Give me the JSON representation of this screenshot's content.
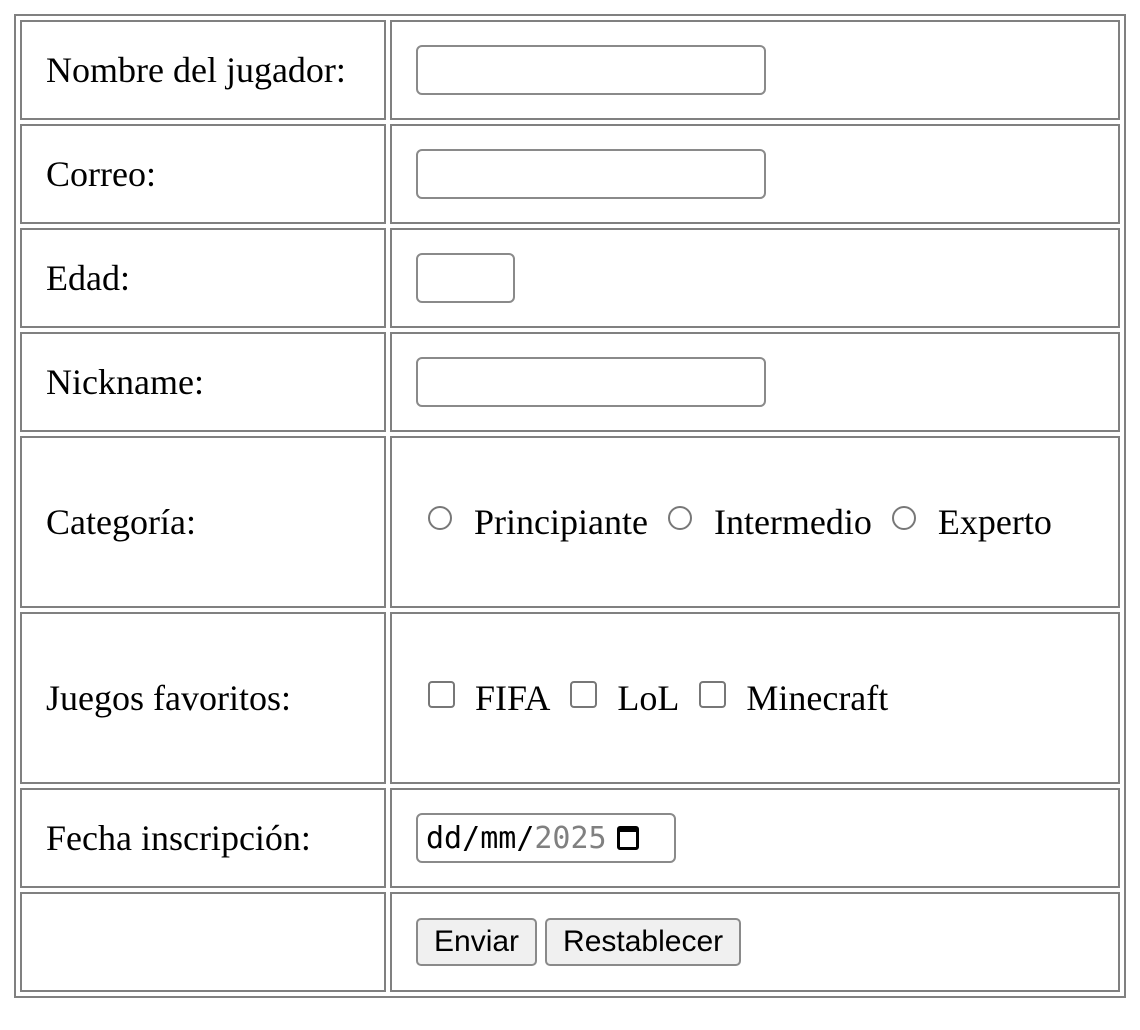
{
  "form": {
    "rows": {
      "nombre": {
        "label": "Nombre del jugador:",
        "value": ""
      },
      "correo": {
        "label": "Correo:",
        "value": ""
      },
      "edad": {
        "label": "Edad:",
        "value": ""
      },
      "nickname": {
        "label": "Nickname:",
        "value": ""
      },
      "categoria": {
        "label": "Categoría:",
        "options": [
          "Principiante",
          "Intermedio",
          "Experto"
        ]
      },
      "juegos": {
        "label": "Juegos favoritos:",
        "options": [
          "FIFA",
          "LoL",
          "Minecraft"
        ]
      },
      "fecha": {
        "label": "Fecha inscripción:",
        "day_placeholder": "dd",
        "month_placeholder": "mm",
        "separator": "/",
        "year": "2025"
      }
    },
    "buttons": {
      "submit_label": "Enviar",
      "reset_label": "Restablecer"
    }
  },
  "icons": {
    "date_picker": "calendar-icon"
  }
}
